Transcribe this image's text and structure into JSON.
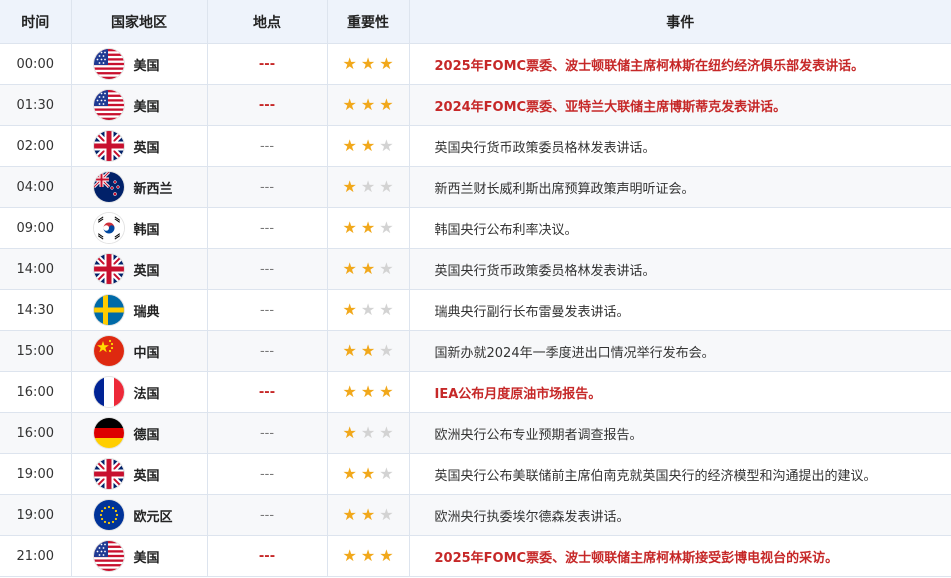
{
  "headers": {
    "time": "时间",
    "country": "国家地区",
    "location": "地点",
    "importance": "重要性",
    "event": "事件"
  },
  "rows": [
    {
      "time": "00:00",
      "flag": "us",
      "country": "美国",
      "location": "---",
      "stars": 3,
      "event": "2025年FOMC票委、波士顿联储主席柯林斯在纽约经济俱乐部发表讲话。",
      "highlight": true
    },
    {
      "time": "01:30",
      "flag": "us",
      "country": "美国",
      "location": "---",
      "stars": 3,
      "event": "2024年FOMC票委、亚特兰大联储主席博斯蒂克发表讲话。",
      "highlight": true
    },
    {
      "time": "02:00",
      "flag": "uk",
      "country": "英国",
      "location": "---",
      "stars": 2,
      "event": "英国央行货币政策委员格林发表讲话。",
      "highlight": false
    },
    {
      "time": "04:00",
      "flag": "nz",
      "country": "新西兰",
      "location": "---",
      "stars": 1,
      "event": "新西兰财长威利斯出席预算政策声明听证会。",
      "highlight": false
    },
    {
      "time": "09:00",
      "flag": "kr",
      "country": "韩国",
      "location": "---",
      "stars": 2,
      "event": "韩国央行公布利率决议。",
      "highlight": false
    },
    {
      "time": "14:00",
      "flag": "uk",
      "country": "英国",
      "location": "---",
      "stars": 2,
      "event": "英国央行货币政策委员格林发表讲话。",
      "highlight": false
    },
    {
      "time": "14:30",
      "flag": "se",
      "country": "瑞典",
      "location": "---",
      "stars": 1,
      "event": "瑞典央行副行长布雷曼发表讲话。",
      "highlight": false
    },
    {
      "time": "15:00",
      "flag": "cn",
      "country": "中国",
      "location": "---",
      "stars": 2,
      "event": "国新办就2024年一季度进出口情况举行发布会。",
      "highlight": false
    },
    {
      "time": "16:00",
      "flag": "fr",
      "country": "法国",
      "location": "---",
      "stars": 3,
      "event": "IEA公布月度原油市场报告。",
      "highlight": true
    },
    {
      "time": "16:00",
      "flag": "de",
      "country": "德国",
      "location": "---",
      "stars": 1,
      "event": "欧洲央行公布专业预期者调查报告。",
      "highlight": false
    },
    {
      "time": "19:00",
      "flag": "uk",
      "country": "英国",
      "location": "---",
      "stars": 2,
      "event": "英国央行公布美联储前主席伯南克就英国央行的经济模型和沟通提出的建议。",
      "highlight": false
    },
    {
      "time": "19:00",
      "flag": "eu",
      "country": "欧元区",
      "location": "---",
      "stars": 2,
      "event": "欧洲央行执委埃尔德森发表讲话。",
      "highlight": false
    },
    {
      "time": "21:00",
      "flag": "us",
      "country": "美国",
      "location": "---",
      "stars": 3,
      "event": "2025年FOMC票委、波士顿联储主席柯林斯接受彭博电视台的采访。",
      "highlight": true
    }
  ],
  "colors": {
    "highlight": "#c62828",
    "star_on": "#f1a81b",
    "star_off": "#d3d3d3",
    "header_bg": "#eef3fb"
  }
}
